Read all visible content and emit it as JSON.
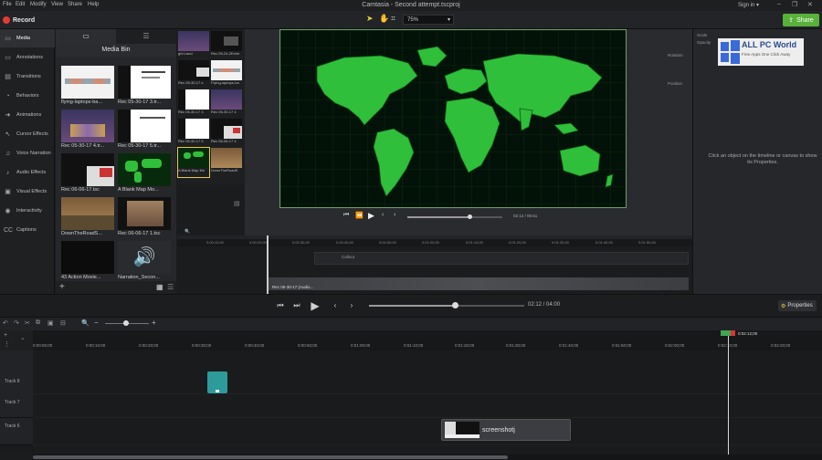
{
  "menubar": {
    "items": [
      "File",
      "Edit",
      "Modify",
      "View",
      "Share",
      "Help"
    ],
    "title": "Camtasia - Second attempt.tscproj",
    "signin": "Sign in ▾"
  },
  "toolbar": {
    "record_label": "Record",
    "zoom_value": "75%",
    "share_label": "Share"
  },
  "sidebar": {
    "items": [
      {
        "label": "Media",
        "icon": "film-icon"
      },
      {
        "label": "Annotations",
        "icon": "annotation-icon"
      },
      {
        "label": "Transitions",
        "icon": "transition-icon"
      },
      {
        "label": "Behaviors",
        "icon": "behavior-icon"
      },
      {
        "label": "Animations",
        "icon": "animation-icon"
      },
      {
        "label": "Cursor Effects",
        "icon": "cursor-icon"
      },
      {
        "label": "Voice Narration",
        "icon": "microphone-icon"
      },
      {
        "label": "Audio Effects",
        "icon": "audio-icon"
      },
      {
        "label": "Visual Effects",
        "icon": "visual-effects-icon"
      },
      {
        "label": "Interactivity",
        "icon": "interactivity-icon"
      },
      {
        "label": "Captions",
        "icon": "captions-icon"
      }
    ]
  },
  "media_bin": {
    "title": "Media Bin",
    "items": [
      {
        "caption": "flying-laptops-ba..."
      },
      {
        "caption": "Rec 05-30-17 3.tr..."
      },
      {
        "caption": "Rec 05-30-17 4.tr..."
      },
      {
        "caption": "Rec 05-30-17 5.tr..."
      },
      {
        "caption": "Rec 06-06-17.tsc"
      },
      {
        "caption": "A Blank Map Mo..."
      },
      {
        "caption": "DownTheRoadS..."
      },
      {
        "caption": "Rec 06-06-17 1.tsc"
      },
      {
        "caption": "43 Action Movie..."
      },
      {
        "caption": "Narration_Secon..."
      }
    ]
  },
  "media_bin2": {
    "items": [
      {
        "caption": "ght.Laod"
      },
      {
        "caption": "Rec 05-24-2Extre"
      },
      {
        "caption": "Rec 05-30-17 s"
      },
      {
        "caption": "Flying-laptops-ba"
      },
      {
        "caption": "Rec 05-30-17 3"
      },
      {
        "caption": "Rec 05-30-17 4"
      },
      {
        "caption": "Rec 05-30-17 5"
      },
      {
        "caption": "Rec 06-06-17 4"
      },
      {
        "caption": "A Blank Map Mo"
      },
      {
        "caption": "DownTheRoadS"
      }
    ]
  },
  "preview": {
    "time": "02:12 / 05:51"
  },
  "properties": {
    "hint": "Click an object on the timeline or canvas to show its Properties.",
    "labels": [
      "Scale",
      "Opacity",
      "Rotation",
      "Position"
    ]
  },
  "watermark": {
    "title": "ALL PC World",
    "subtitle": "Free Apps One Click Away"
  },
  "mini_timeline": {
    "clip_label": "Callout",
    "audio_label": "Rec 05-30-17 (Audio...",
    "ticks": [
      "0:00:10;00",
      "0:00:20;00",
      "0:00:30;00",
      "0:00:40;00",
      "0:00:50;00",
      "0:01:00;00",
      "0:01:10;00",
      "0:01:20;00",
      "0:01:30;00",
      "0:01:40;00",
      "0:01:50;00",
      "0:02:00;00",
      "0:02:10;00",
      "0:02:20;00"
    ]
  },
  "transport": {
    "time": "02:12",
    "total": "04:00",
    "progress": 0.55,
    "properties_label": "Properties"
  },
  "timeline": {
    "ticks": [
      "0:00:00;00",
      "0:00:10;00",
      "0:00:20;00",
      "0:00:30;00",
      "0:00:40;00",
      "0:00:50;00",
      "0:01:00;00",
      "0:01:10;00",
      "0:01:20;00",
      "0:01:30;00",
      "0:01:40;00",
      "0:01:50;00",
      "0:02:00;00",
      "0:02:10;00",
      "0:02:20;00",
      "0:02:30;00"
    ],
    "playhead_time": "0:02:12;00",
    "tracks": [
      {
        "name": "Track 8"
      },
      {
        "name": "Track 7"
      },
      {
        "name": "Track 6"
      }
    ],
    "clip_label": "screenshotj"
  },
  "colors": {
    "accent_green": "#58b13a",
    "record_red": "#e53935",
    "clip_teal": "#2d9b9b",
    "map_green": "#2fbf3a"
  }
}
